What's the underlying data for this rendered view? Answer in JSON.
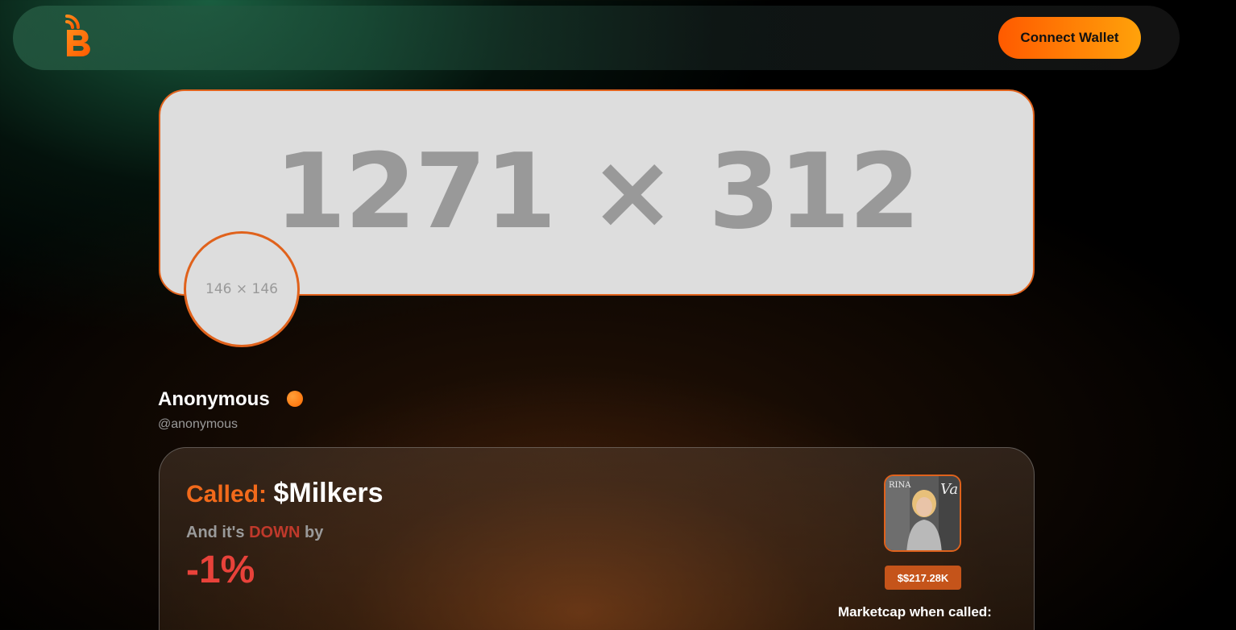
{
  "header": {
    "connect_wallet_label": "Connect Wallet"
  },
  "banner": {
    "placeholder_text": "1271 × 312"
  },
  "avatar": {
    "placeholder_text": "146 × 146"
  },
  "profile": {
    "name": "Anonymous",
    "handle": "@anonymous"
  },
  "call": {
    "called_label": "Called:",
    "ticker": "$Milkers",
    "down_prefix": "And it's",
    "down_word": "DOWN",
    "down_suffix": "by",
    "change_percent": "-1%",
    "market_cap_badge": "$$217.28K",
    "market_cap_called_label": "Marketcap when called:"
  },
  "colors": {
    "accent": "#f26a1b",
    "button_gradient_start": "#ff5a00",
    "button_gradient_end": "#ffa20a",
    "down_color": "#e8423a",
    "badge_bg": "#c5541a"
  },
  "icons": {
    "logo": "brand-logo-b-broadcast-icon",
    "verified": "status-dot-icon"
  }
}
